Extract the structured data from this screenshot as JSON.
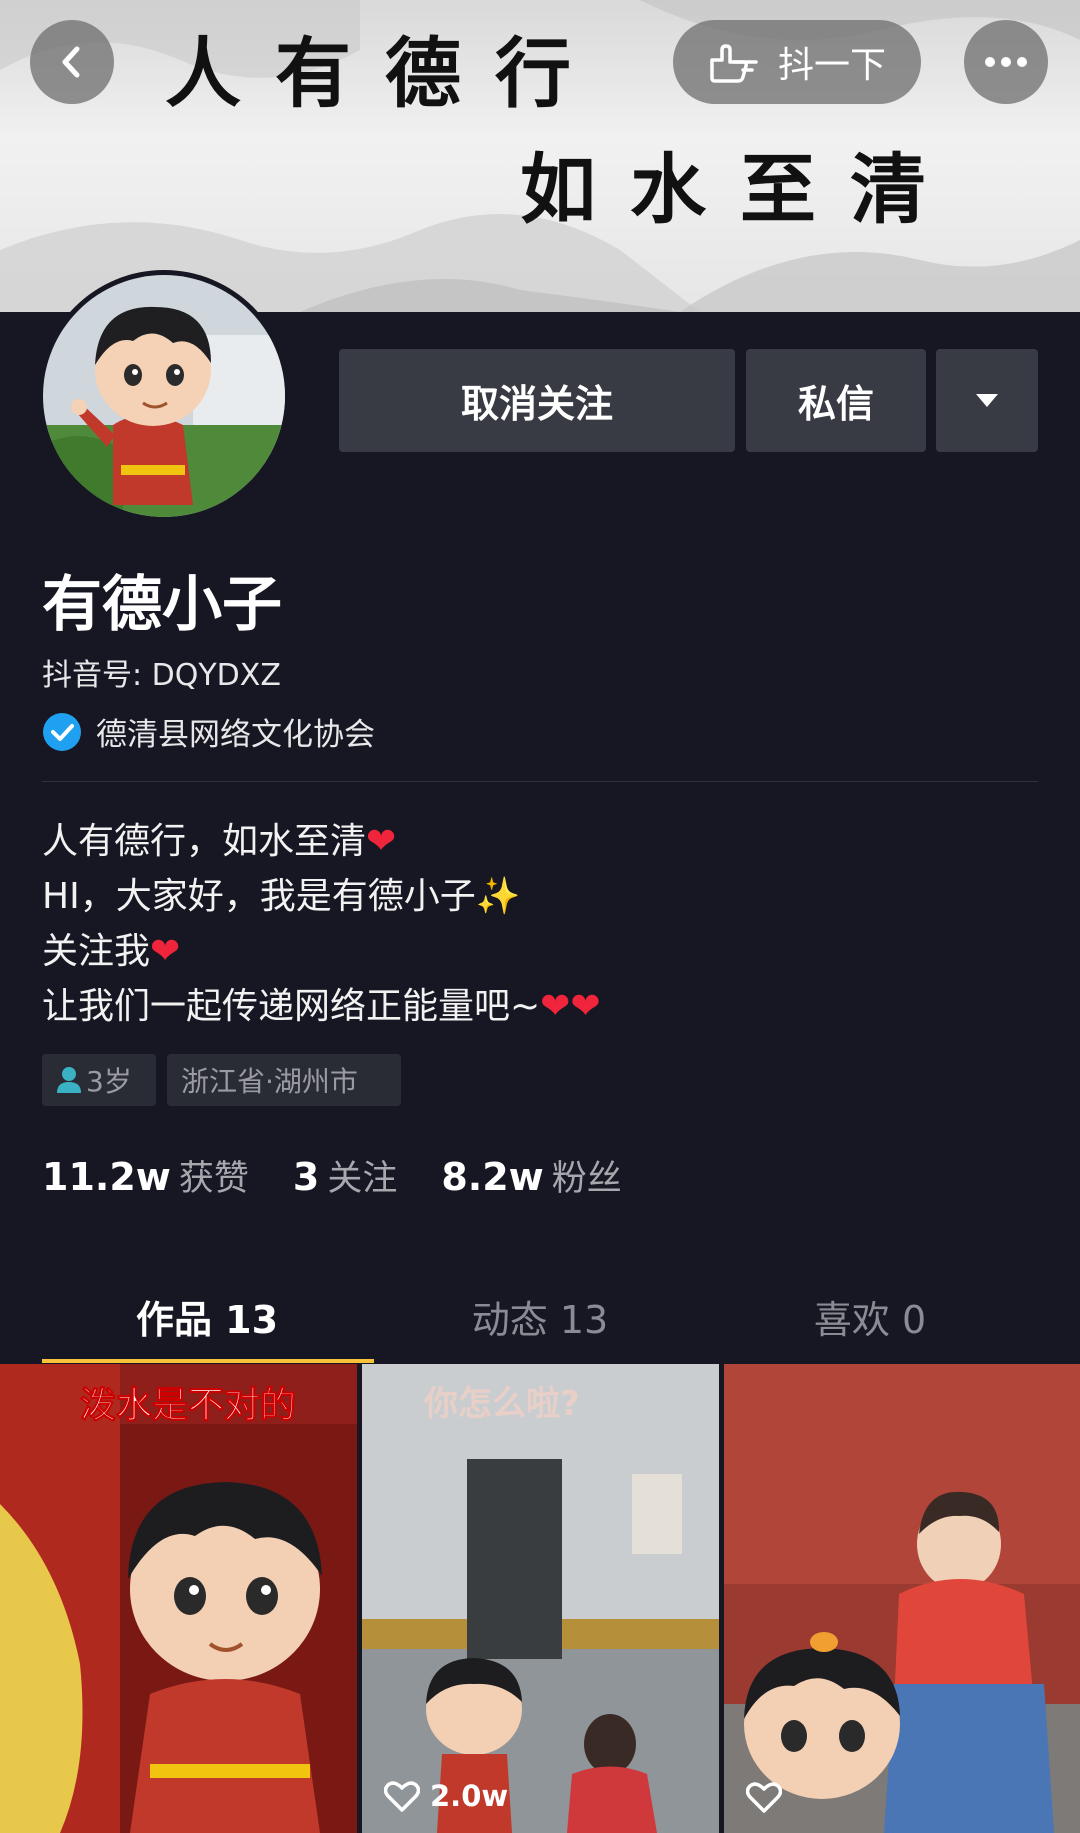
{
  "banner": {
    "calligraphy_line1": "人有德行",
    "calligraphy_line2": "如水至清",
    "shake_label": "抖一下"
  },
  "actions": {
    "unfollow_label": "取消关注",
    "message_label": "私信"
  },
  "profile": {
    "nickname": "有德小子",
    "douyin_id": "抖音号: DQYDXZ",
    "verification": "德清县网络文化协会"
  },
  "bio": {
    "line1": "人有德行，如水至清",
    "line1_emoji": "❤",
    "line2": "HI，大家好，我是有德小子",
    "line2_emoji": "✨",
    "line3": "关注我",
    "line3_emoji": "❤",
    "line4": "让我们一起传递网络正能量吧~",
    "line4_emoji": "❤❤"
  },
  "tags": {
    "age": "3岁",
    "location": "浙江省·湖州市"
  },
  "stats": [
    {
      "value": "11.2w",
      "label": "获赞"
    },
    {
      "value": "3",
      "label": "关注"
    },
    {
      "value": "8.2w",
      "label": "粉丝"
    }
  ],
  "tabs": [
    {
      "label": "作品 13",
      "active": true
    },
    {
      "label": "动态 13",
      "active": false
    },
    {
      "label": "喜欢 0",
      "active": false
    }
  ],
  "videos": [
    {
      "caption": "泼水是不对的",
      "likes": ""
    },
    {
      "caption": "你怎么啦?",
      "likes": "2.0w"
    },
    {
      "caption": "",
      "likes": ""
    }
  ],
  "colors": {
    "background": "#161722",
    "button": "#393b44",
    "tab_underline": "#f8c23a",
    "verified_blue": "#20a0f0",
    "heart_red": "#f0243a"
  },
  "icons": [
    "back-arrow-icon",
    "pointing-hand-icon",
    "more-dots-icon",
    "dropdown-caret-icon",
    "verified-check-icon",
    "person-icon",
    "heart-outline-icon"
  ]
}
